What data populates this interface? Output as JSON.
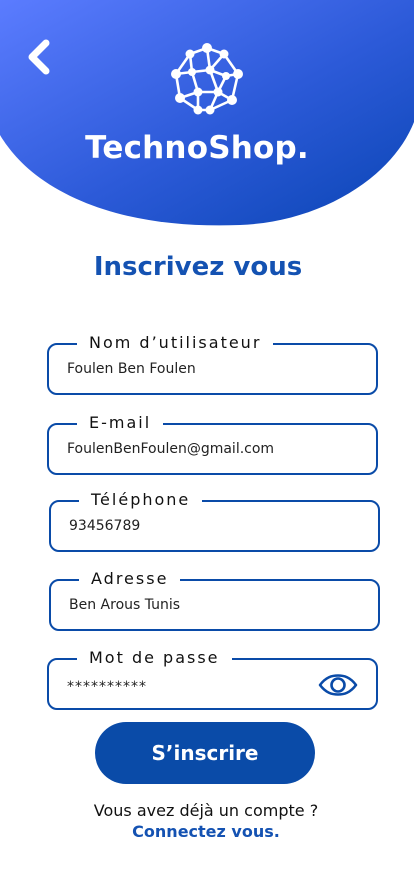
{
  "brand": {
    "name": "TechnoShop.",
    "logo_icon": "network-globe-icon"
  },
  "nav": {
    "back_icon": "chevron-left-icon"
  },
  "form": {
    "title": "Inscrivez vous",
    "fields": [
      {
        "label": "Nom d’utilisateur",
        "value": "Foulen Ben Foulen"
      },
      {
        "label": "E-mail",
        "value": "FoulenBenFoulen@gmail.com"
      },
      {
        "label": "Téléphone",
        "value": "93456789"
      },
      {
        "label": "Adresse",
        "value": "Ben Arous Tunis"
      },
      {
        "label": "Mot de passe",
        "value": "**********",
        "toggle_icon": "eye-icon"
      }
    ],
    "submit_label": "S’inscrire"
  },
  "footer": {
    "prompt": "Vous avez déjà un compte ?",
    "link": "Connectez vous."
  },
  "colors": {
    "primary": "#0A4BA8",
    "gradient_start": "#5B7CFF",
    "gradient_end": "#0A49B6",
    "title": "#1452B2"
  }
}
